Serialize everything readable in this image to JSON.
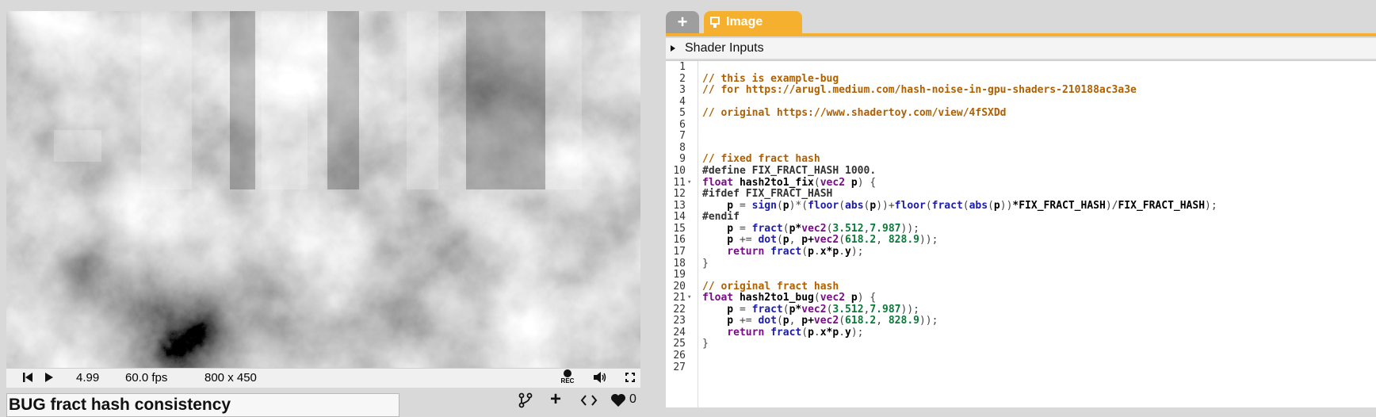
{
  "player": {
    "time": "4.99",
    "fps": "60.0 fps",
    "resolution": "800 x 450",
    "rec_label": "REC"
  },
  "shader": {
    "title": "BUG fract hash consistency",
    "likes": "0"
  },
  "tabs": {
    "add_label": "+",
    "image_label": "Image"
  },
  "shader_inputs_label": "Shader Inputs",
  "code_lines": [
    [],
    [
      [
        "cm",
        "// this is example-bug"
      ]
    ],
    [
      [
        "cm",
        "// for https://arugl.medium.com/hash-noise-in-gpu-shaders-210188ac3a3e"
      ]
    ],
    [],
    [
      [
        "cm",
        "// original https://www.shadertoy.com/view/4fSXDd"
      ]
    ],
    [],
    [],
    [],
    [
      [
        "cm",
        "// fixed fract hash"
      ]
    ],
    [
      [
        "pp",
        "#define FIX_FRACT_HASH 1000."
      ]
    ],
    [
      [
        "kw",
        "float"
      ],
      [
        "id",
        " hash2to1_fix"
      ],
      [
        "pu",
        "("
      ],
      [
        "kw",
        "vec2"
      ],
      [
        "id",
        " p"
      ],
      [
        "pu",
        ") {"
      ]
    ],
    [
      [
        "pp",
        "#ifdef FIX_FRACT_HASH"
      ]
    ],
    [
      [
        "id",
        "    p "
      ],
      [
        "pu",
        "= "
      ],
      [
        "fn",
        "sign"
      ],
      [
        "pu",
        "("
      ],
      [
        "id",
        "p"
      ],
      [
        "pu",
        ")*("
      ],
      [
        "fn",
        "floor"
      ],
      [
        "pu",
        "("
      ],
      [
        "fn",
        "abs"
      ],
      [
        "pu",
        "("
      ],
      [
        "id",
        "p"
      ],
      [
        "pu",
        "))+"
      ],
      [
        "fn",
        "floor"
      ],
      [
        "pu",
        "("
      ],
      [
        "fn",
        "fract"
      ],
      [
        "pu",
        "("
      ],
      [
        "fn",
        "abs"
      ],
      [
        "pu",
        "("
      ],
      [
        "id",
        "p"
      ],
      [
        "pu",
        "))"
      ],
      [
        "id",
        "*FIX_FRACT_HASH"
      ],
      [
        "pu",
        ")/"
      ],
      [
        "id",
        "FIX_FRACT_HASH"
      ],
      [
        "pu",
        ");"
      ]
    ],
    [
      [
        "pp",
        "#endif"
      ]
    ],
    [
      [
        "id",
        "    p "
      ],
      [
        "pu",
        "= "
      ],
      [
        "fn",
        "fract"
      ],
      [
        "pu",
        "("
      ],
      [
        "id",
        "p*"
      ],
      [
        "kw",
        "vec2"
      ],
      [
        "pu",
        "("
      ],
      [
        "nu",
        "3.512"
      ],
      [
        "pu",
        ","
      ],
      [
        "nu",
        "7.987"
      ],
      [
        "pu",
        "));"
      ]
    ],
    [
      [
        "id",
        "    p "
      ],
      [
        "pu",
        "+= "
      ],
      [
        "fn",
        "dot"
      ],
      [
        "pu",
        "("
      ],
      [
        "id",
        "p"
      ],
      [
        "pu",
        ", "
      ],
      [
        "id",
        "p+"
      ],
      [
        "kw",
        "vec2"
      ],
      [
        "pu",
        "("
      ],
      [
        "nu",
        "618.2"
      ],
      [
        "pu",
        ", "
      ],
      [
        "nu",
        "828.9"
      ],
      [
        "pu",
        "));"
      ]
    ],
    [
      [
        "kw",
        "    return "
      ],
      [
        "fn",
        "fract"
      ],
      [
        "pu",
        "("
      ],
      [
        "id",
        "p"
      ],
      [
        "pu",
        "."
      ],
      [
        "id",
        "x*p"
      ],
      [
        "pu",
        "."
      ],
      [
        "id",
        "y"
      ],
      [
        "pu",
        ");"
      ]
    ],
    [
      [
        "pu",
        "}"
      ]
    ],
    [],
    [
      [
        "cm",
        "// original fract hash"
      ]
    ],
    [
      [
        "kw",
        "float"
      ],
      [
        "id",
        " hash2to1_bug"
      ],
      [
        "pu",
        "("
      ],
      [
        "kw",
        "vec2"
      ],
      [
        "id",
        " p"
      ],
      [
        "pu",
        ") {"
      ]
    ],
    [
      [
        "id",
        "    p "
      ],
      [
        "pu",
        "= "
      ],
      [
        "fn",
        "fract"
      ],
      [
        "pu",
        "("
      ],
      [
        "id",
        "p*"
      ],
      [
        "kw",
        "vec2"
      ],
      [
        "pu",
        "("
      ],
      [
        "nu",
        "3.512"
      ],
      [
        "pu",
        ","
      ],
      [
        "nu",
        "7.987"
      ],
      [
        "pu",
        "));"
      ]
    ],
    [
      [
        "id",
        "    p "
      ],
      [
        "pu",
        "+= "
      ],
      [
        "fn",
        "dot"
      ],
      [
        "pu",
        "("
      ],
      [
        "id",
        "p"
      ],
      [
        "pu",
        ", "
      ],
      [
        "id",
        "p+"
      ],
      [
        "kw",
        "vec2"
      ],
      [
        "pu",
        "("
      ],
      [
        "nu",
        "618.2"
      ],
      [
        "pu",
        ", "
      ],
      [
        "nu",
        "828.9"
      ],
      [
        "pu",
        "));"
      ]
    ],
    [
      [
        "kw",
        "    return "
      ],
      [
        "fn",
        "fract"
      ],
      [
        "pu",
        "("
      ],
      [
        "id",
        "p"
      ],
      [
        "pu",
        "."
      ],
      [
        "id",
        "x*p"
      ],
      [
        "pu",
        "."
      ],
      [
        "id",
        "y"
      ],
      [
        "pu",
        ");"
      ]
    ],
    [
      [
        "pu",
        "}"
      ]
    ],
    [],
    []
  ],
  "fold_lines": [
    11,
    21
  ],
  "colors": {
    "accent": "#f5b030",
    "comment": "#b06000",
    "keyword": "#7a0a8a",
    "function": "#1c1cb0",
    "number": "#0a7a3a"
  }
}
